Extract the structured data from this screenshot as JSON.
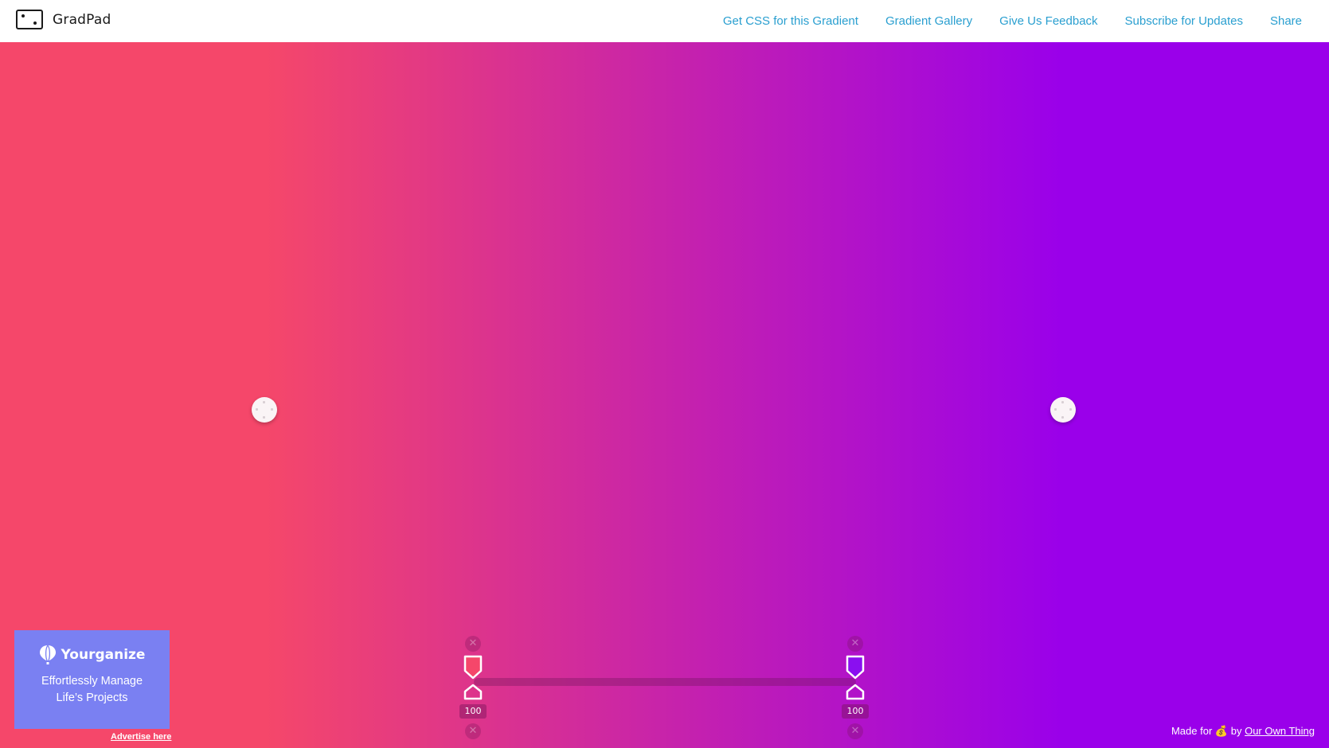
{
  "app": {
    "title": "GradPad",
    "logo_icon": "dice-frame-icon"
  },
  "nav": {
    "items": [
      {
        "label": "Get CSS for this Gradient"
      },
      {
        "label": "Gradient Gallery"
      },
      {
        "label": "Give Us Feedback"
      },
      {
        "label": "Subscribe for Updates"
      },
      {
        "label": "Share"
      }
    ],
    "link_color": "#2a9fd0"
  },
  "gradient": {
    "type": "linear",
    "direction": "horizontal",
    "stops": [
      {
        "color": "#f5476a",
        "opacity": "100"
      },
      {
        "color": "#9a00ea",
        "opacity": "100"
      }
    ]
  },
  "stops_editor": {
    "stops": [
      {
        "opacity_label": "100",
        "color": "#f5476a",
        "delete_icon": "close-icon"
      },
      {
        "opacity_label": "100",
        "color": "#8a0ff0",
        "delete_icon": "close-icon"
      }
    ]
  },
  "ad": {
    "brand": "Yourganize",
    "brand_icon": "balloon-icon",
    "tagline_line1": "Effortlessly Manage",
    "tagline_line2": "Life’s Projects",
    "advertise_label": "Advertise here",
    "background": "#7a80f2"
  },
  "footer": {
    "made_for": "Made for",
    "emoji": "💰",
    "by": "by",
    "link": "Our Own Thing"
  }
}
